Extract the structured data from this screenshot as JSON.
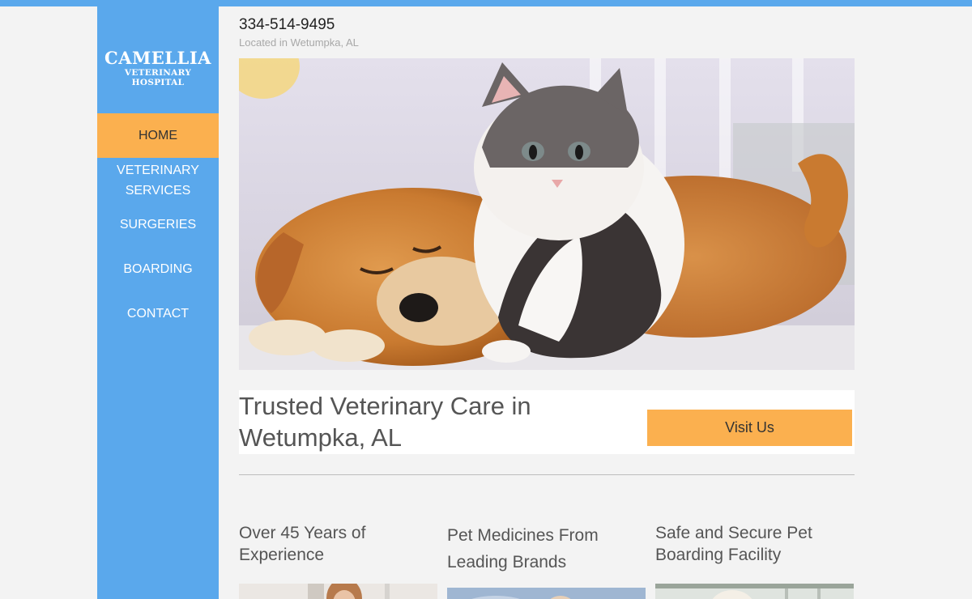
{
  "brand": {
    "name": "CAMELLIA",
    "subtitle": "VETERINARY HOSPITAL"
  },
  "colors": {
    "primary": "#5aa8ec",
    "accent": "#fbb04f",
    "background": "#f3f3f3"
  },
  "nav": {
    "items": [
      {
        "label": "HOME",
        "active": true
      },
      {
        "label": "VETERINARY SERVICES",
        "active": false
      },
      {
        "label": "SURGERIES",
        "active": false
      },
      {
        "label": "BOARDING",
        "active": false
      },
      {
        "label": "CONTACT",
        "active": false
      }
    ]
  },
  "header": {
    "phone": "334-514-9495",
    "location": "Located in Wetumpka, AL"
  },
  "cta": {
    "heading": "Trusted Veterinary Care in Wetumpka, AL",
    "button": "Visit Us"
  },
  "features": [
    {
      "title": "Over 45 Years of Experience"
    },
    {
      "title": "Pet Medicines From Leading Brands"
    },
    {
      "title": "Safe and Secure Pet Boarding Facility"
    }
  ]
}
